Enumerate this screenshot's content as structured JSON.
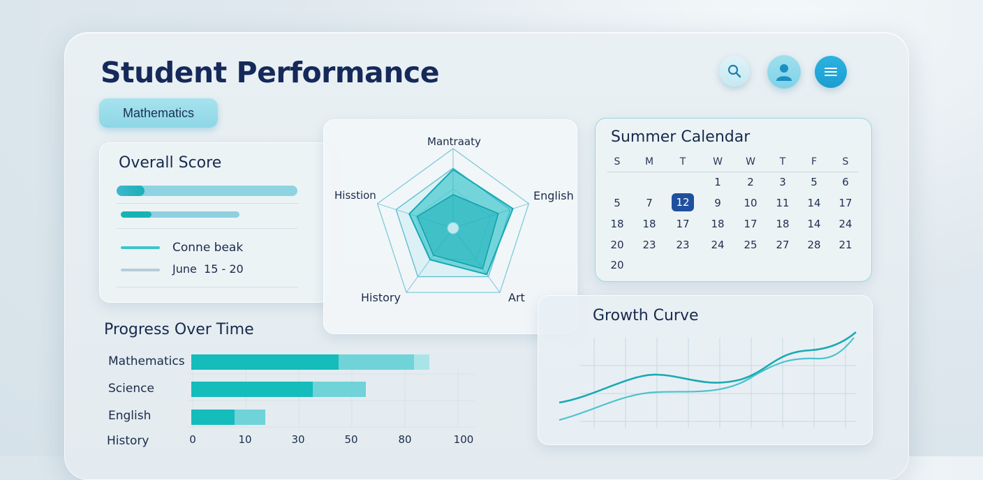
{
  "header": {
    "title": "Student Performance",
    "subject": "Mathematics"
  },
  "icons": {
    "search": "search-icon",
    "profile": "user-icon",
    "menu": "menu-icon"
  },
  "colors": {
    "accent": "#1aa7d6",
    "teal": "#14bcbc",
    "teal_light": "#6fd3d8",
    "navy": "#15295a",
    "selected_day": "#1f4f9e"
  },
  "overall": {
    "title": "Overall Score",
    "legend": [
      {
        "label": "Conne beak"
      },
      {
        "label": "June  15 - 20"
      }
    ]
  },
  "radar": {
    "axes": [
      "Mantraaty",
      "English",
      "Art",
      "History",
      "Hisstion"
    ]
  },
  "calendar": {
    "title": "Summer Calendar",
    "weekdays": [
      "S",
      "M",
      "T",
      "W",
      "W",
      "T",
      "F",
      "S"
    ],
    "weeks": [
      [
        "",
        "",
        "",
        "1",
        "2",
        "3",
        "5",
        "6"
      ],
      [
        "5",
        "7",
        "12",
        "9",
        "10",
        "11",
        "14",
        "17"
      ],
      [
        "18",
        "18",
        "17",
        "18",
        "17",
        "18",
        "14",
        "24"
      ],
      [
        "20",
        "23",
        "23",
        "24",
        "25",
        "27",
        "28",
        "21"
      ],
      [
        "20",
        "",
        "",
        "",
        "",
        "",
        "",
        ""
      ]
    ],
    "selected": "12"
  },
  "progress": {
    "title": "Progress Over Time",
    "categories": [
      "Mathematics",
      "Science",
      "English",
      "History"
    ],
    "ticks": [
      "0",
      "10",
      "30",
      "50",
      "80",
      "100"
    ]
  },
  "growth": {
    "title": "Growth Curve"
  }
}
